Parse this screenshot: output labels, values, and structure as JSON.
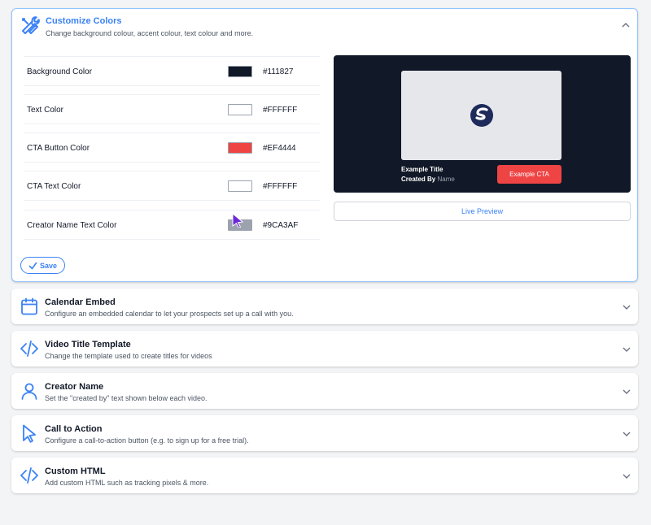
{
  "colors": {
    "accent": "#3b82f6",
    "panel_border_active": "#93c5fd"
  },
  "customize": {
    "title": "Customize Colors",
    "subtitle": "Change background colour, accent colour, text colour and more.",
    "icon": "tools-icon",
    "rows": [
      {
        "label": "Background Color",
        "hex": "#111827"
      },
      {
        "label": "Text Color",
        "hex": "#FFFFFF"
      },
      {
        "label": "CTA Button Color",
        "hex": "#EF4444"
      },
      {
        "label": "CTA Text Color",
        "hex": "#FFFFFF"
      },
      {
        "label": "Creator Name Text Color",
        "hex": "#9CA3AF"
      }
    ],
    "preview": {
      "title": "Example Title",
      "created_by": "Created By",
      "name": "Name",
      "cta": "Example CTA"
    },
    "live_preview": "Live Preview",
    "save": "Save"
  },
  "sections": [
    {
      "title": "Calendar Embed",
      "subtitle": "Configure an embedded calendar to let your prospects set up a call with you.",
      "icon": "calendar-icon"
    },
    {
      "title": "Video Title Template",
      "subtitle": "Change the template used to create titles for videos",
      "icon": "code-icon"
    },
    {
      "title": "Creator Name",
      "subtitle": "Set the \"created by\" text shown below each video.",
      "icon": "user-icon"
    },
    {
      "title": "Call to Action",
      "subtitle": "Configure a call-to-action button (e.g. to sign up for a free trial).",
      "icon": "cursor-arrow-icon"
    },
    {
      "title": "Custom HTML",
      "subtitle": "Add custom HTML such as tracking pixels & more.",
      "icon": "code-icon"
    }
  ]
}
